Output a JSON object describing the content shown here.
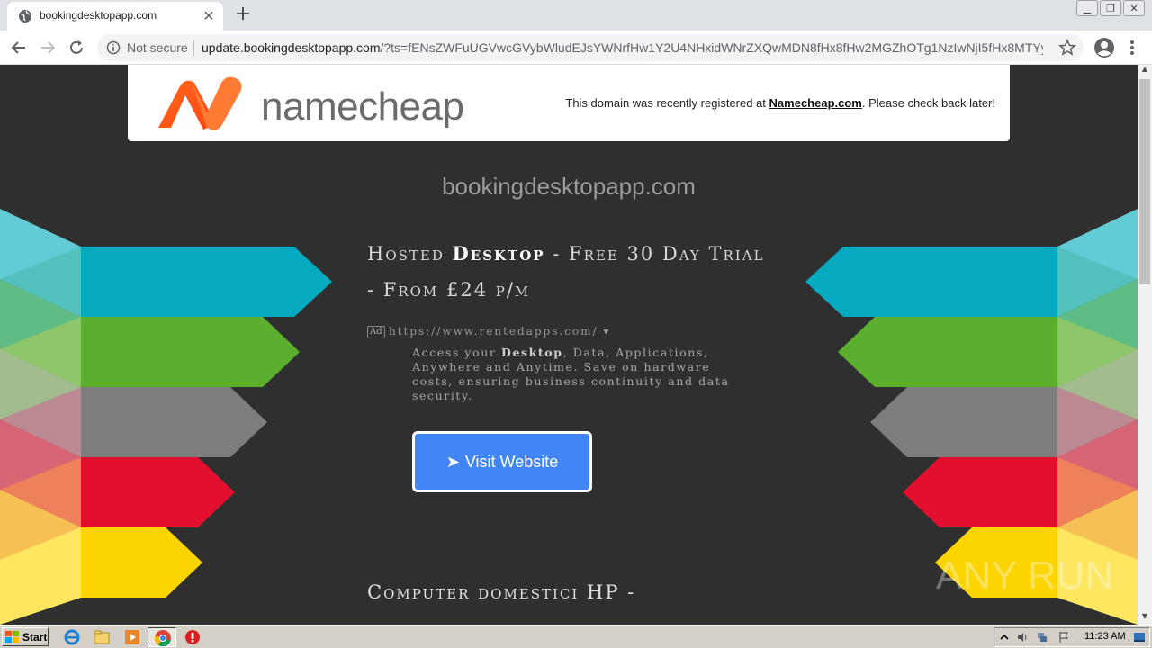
{
  "browser": {
    "tab_title": "bookingdesktopapp.com",
    "tab_close": "✕",
    "new_tab": "+",
    "security_label": "Not secure",
    "url_host": "update.bookingdesktopapp.com",
    "url_path": "/?ts=fENsZWFuUGVwcGVybWludEJsYWNrfHw1Y2U4NHxidWNrZXQwMDN8fHx8fHw2MGZhOTg1NzIwNjI5fHx8MTYyNz...",
    "window_controls": [
      "▁",
      "❐",
      "✕"
    ]
  },
  "header": {
    "logo_text": "namecheap",
    "notice_prefix": "This domain was recently registered at ",
    "notice_link": "Namecheap.com",
    "notice_suffix": ". Please check back later!"
  },
  "domain": "bookingdesktopapp.com",
  "ad": {
    "title_pre": "Hosted ",
    "title_bold": "Desktop",
    "title_post": " - Free 30 Day Trial - From £24 p/m",
    "badge": "Ad",
    "url": "https://www.rentedapps.com/  ▾",
    "desc_pre": "Access your ",
    "desc_bold": "Desktop",
    "desc_post": ", Data, Applications, Anywhere and Anytime. Save on hardware costs, ensuring business continuity and data security.",
    "button_arrow": "➤",
    "button_label": "Visit Website"
  },
  "second_ad": {
    "title": "Computer domestici HP -"
  },
  "watermark": "ANY RUN",
  "taskbar": {
    "start_label": "Start",
    "clock": "11:23 AM"
  },
  "colors": {
    "stripes": [
      "#05aac0",
      "#5aaf2e",
      "#7d7d7d",
      "#e2102e",
      "#fcd500"
    ],
    "button": "#4285f4",
    "namecheap_orange": "#ff5a1f"
  }
}
